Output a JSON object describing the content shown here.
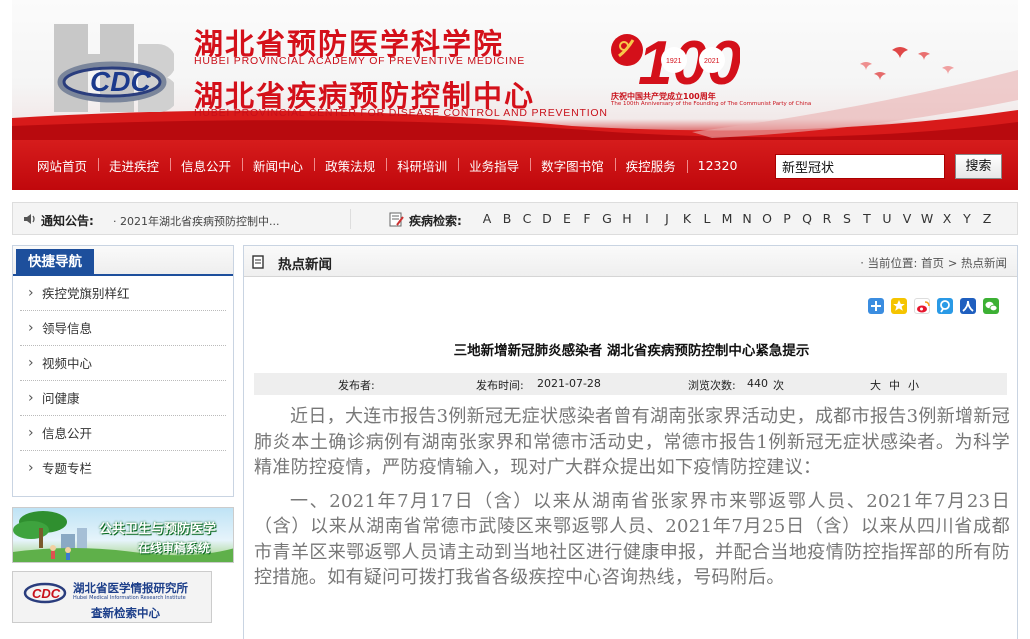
{
  "header": {
    "org1_cn": "湖北省预防医学科学院",
    "org1_en": "HUBEI PROVINCIAL ACADEMY OF PREVENTIVE MEDICINE",
    "org2_cn": "湖北省疾病预防控制中心",
    "org2_en": "HUBEI PROVINCIAL CENTER FOR DISEASE CONTROL AND PREVENTION",
    "logo_text": "CDC",
    "anniversary": {
      "number": "100",
      "year_start": "1921",
      "year_end": "2021",
      "caption_cn": "庆祝中国共产党成立100周年",
      "caption_en": "The 100th Anniversary of the Founding of The Communist Party of China"
    }
  },
  "nav": {
    "items": [
      "网站首页",
      "走进疾控",
      "信息公开",
      "新闻中心",
      "政策法规",
      "科研培训",
      "业务指导",
      "数字图书馆",
      "疾控服务",
      "12320"
    ],
    "search_value": "新型冠状",
    "search_button": "搜索"
  },
  "notice": {
    "label": "通知公告:",
    "text": "· 2021年湖北省疾病预防控制中...",
    "disease_label": "疾病检索:",
    "letters": [
      "A",
      "B",
      "C",
      "D",
      "E",
      "F",
      "G",
      "H",
      "I",
      "J",
      "K",
      "L",
      "M",
      "N",
      "O",
      "P",
      "Q",
      "R",
      "S",
      "T",
      "U",
      "V",
      "W",
      "X",
      "Y",
      "Z"
    ]
  },
  "quicknav": {
    "title": "快捷导航",
    "items": [
      "疾控党旗别样红",
      "领导信息",
      "视频中心",
      "问健康",
      "信息公开",
      "专题专栏"
    ]
  },
  "banners": {
    "b1_line1": "公共卫生与预防医学",
    "b1_line2": "在线审稿系统",
    "b2_line1": "湖北省医学情报研究所",
    "b2_line2": "Hubei Medical Information Research Institute",
    "b2_line3": "查新检索中心"
  },
  "main": {
    "section_title": "热点新闻",
    "breadcrumb_prefix": "当前位置:",
    "breadcrumb_home": "首页",
    "breadcrumb_current": "热点新闻",
    "share_icons": [
      "plus-share-icon",
      "qzone-icon",
      "weibo-icon",
      "tencent-icon",
      "renren-icon",
      "wechat-icon"
    ],
    "article": {
      "title": "三地新增新冠肺炎感染者 湖北省疾病预防控制中心紧急提示",
      "publisher_label": "发布者:",
      "date_label": "发布时间:",
      "date": "2021-07-28",
      "views_label": "浏览次数:",
      "views": "440",
      "views_unit": "次",
      "font_large": "大",
      "font_medium": "中",
      "font_small": "小",
      "paragraphs": [
        "近日，大连市报告3例新冠无症状感染者曾有湖南张家界活动史，成都市报告3例新增新冠肺炎本土确诊病例有湖南张家界和常德市活动史，常德市报告1例新冠无症状感染者。为科学精准防控疫情，严防疫情输入，现对广大群众提出如下疫情防控建议：",
        "一、2021年7月17日（含）以来从湖南省张家界市来鄂返鄂人员、2021年7月23日（含）以来从湖南省常德市武陵区来鄂返鄂人员、2021年7月25日（含）以来从四川省成都市青羊区来鄂返鄂人员请主动到当地社区进行健康申报，并配合当地疫情防控指挥部的所有防控措施。如有疑问可拨打我省各级疾控中心咨询热线，号码附后。"
      ]
    }
  },
  "colors": {
    "brand_red": "#c0080c",
    "nav_blue": "#1d4f9c"
  }
}
